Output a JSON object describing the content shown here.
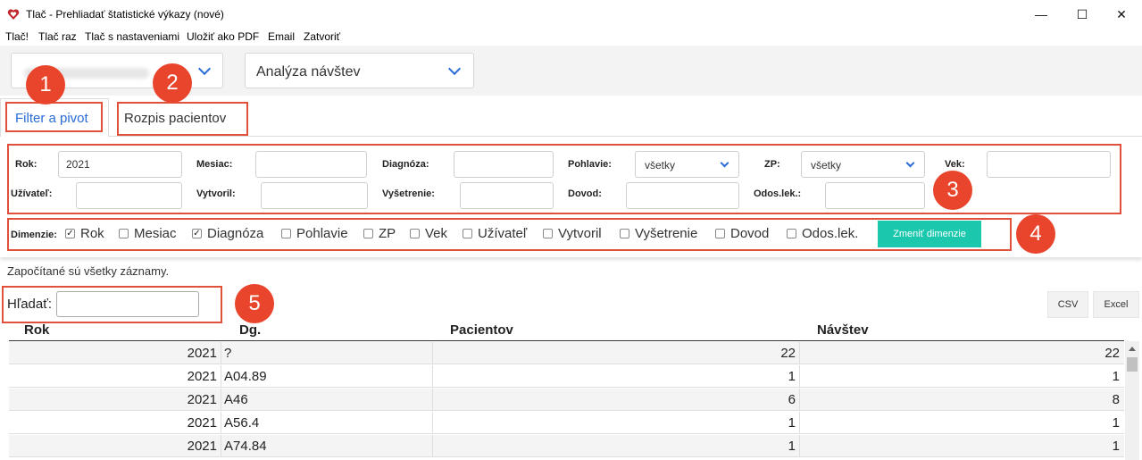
{
  "window": {
    "title": "Tlač - Prehliadať štatistické výkazy (nové)",
    "minimize": "—",
    "maximize": "☐",
    "close": "✕"
  },
  "menu": [
    "Tlač!",
    "Tlač raz",
    "Tlač s nastaveniami",
    "Uložiť ako PDF",
    "Email",
    "Zatvoriť"
  ],
  "selects": {
    "report_type": "Analýza návštev"
  },
  "tabs": [
    {
      "label": "Filter a pivot",
      "active": true
    },
    {
      "label": "Rozpis pacientov",
      "active": false
    }
  ],
  "filters": {
    "rok": {
      "label": "Rok:",
      "value": "2021"
    },
    "mesiac": {
      "label": "Mesiac:",
      "value": ""
    },
    "diagnoza": {
      "label": "Diagnóza:",
      "value": ""
    },
    "pohlavie": {
      "label": "Pohlavie:",
      "value": "všetky"
    },
    "zp": {
      "label": "ZP:",
      "value": "všetky"
    },
    "vek": {
      "label": "Vek:",
      "value": ""
    },
    "uzivatel": {
      "label": "Užívateľ:",
      "value": ""
    },
    "vytvoril": {
      "label": "Vytvoril:",
      "value": ""
    },
    "vysetrenie": {
      "label": "Vyšetrenie:",
      "value": ""
    },
    "dovod": {
      "label": "Dovod:",
      "value": ""
    },
    "odos_lek": {
      "label": "Odos.lek.:",
      "value": ""
    }
  },
  "dimensions": {
    "label": "Dimenzie:",
    "items": [
      {
        "label": "Rok",
        "checked": true
      },
      {
        "label": "Mesiac",
        "checked": false
      },
      {
        "label": "Diagnóza",
        "checked": true
      },
      {
        "label": "Pohlavie",
        "checked": false
      },
      {
        "label": "ZP",
        "checked": false
      },
      {
        "label": "Vek",
        "checked": false
      },
      {
        "label": "Užívateľ",
        "checked": false
      },
      {
        "label": "Vytvoril",
        "checked": false
      },
      {
        "label": "Vyšetrenie",
        "checked": false
      },
      {
        "label": "Dovod",
        "checked": false
      },
      {
        "label": "Odos.lek.",
        "checked": false
      }
    ],
    "button": "Zmeniť dimenzie"
  },
  "badges": [
    "1",
    "2",
    "3",
    "4",
    "5"
  ],
  "info": "Započítané sú všetky záznamy.",
  "search": {
    "label": "Hľadať:",
    "value": ""
  },
  "export": {
    "csv": "CSV",
    "excel": "Excel"
  },
  "table": {
    "headers": [
      "Rok",
      "Dg.",
      "Pacientov",
      "Návštev"
    ],
    "rows": [
      [
        "2021",
        "?",
        "22",
        "22"
      ],
      [
        "2021",
        "A04.89",
        "1",
        "1"
      ],
      [
        "2021",
        "A46",
        "6",
        "8"
      ],
      [
        "2021",
        "A56.4",
        "1",
        "1"
      ],
      [
        "2021",
        "A74.84",
        "1",
        "1"
      ]
    ]
  },
  "colors": {
    "accent_red": "#e8452c",
    "button_green": "#1bc8ae",
    "tab_blue": "#2a6dd8"
  }
}
